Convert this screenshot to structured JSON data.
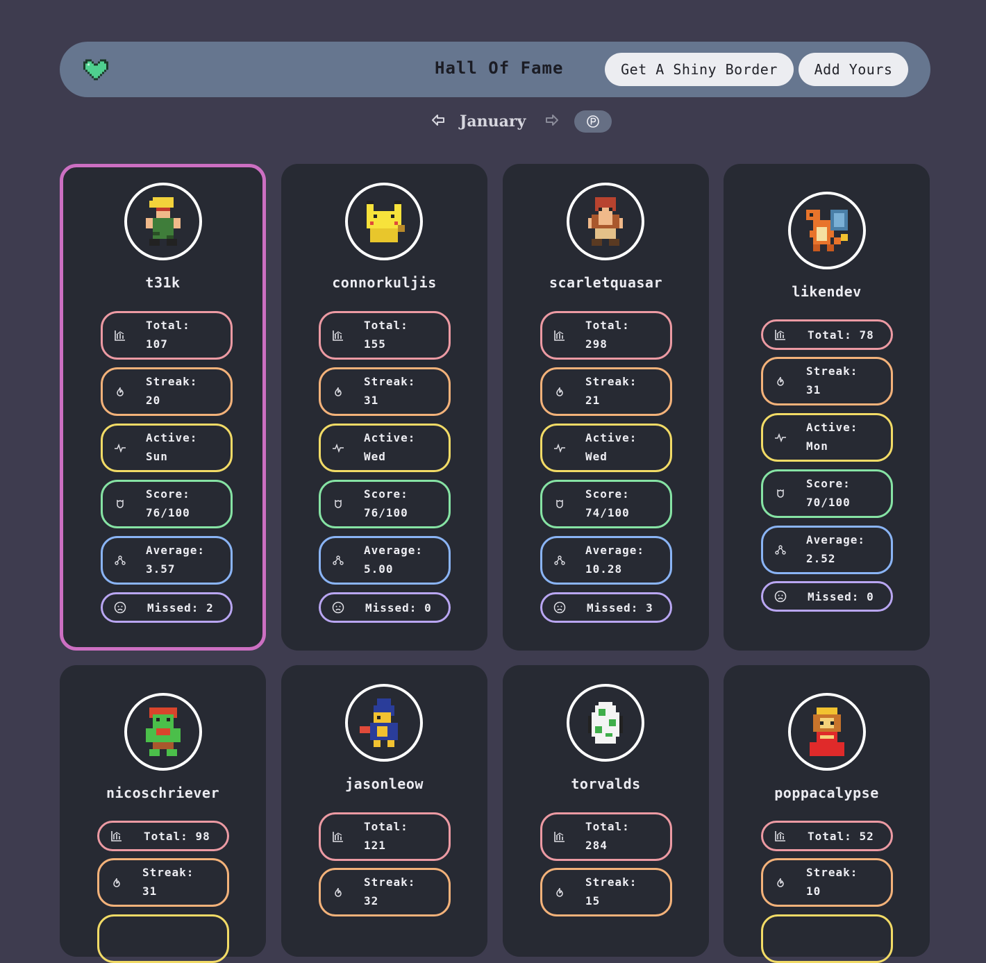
{
  "header": {
    "title": "Hall Of Fame",
    "shiny_button": "Get A Shiny Border",
    "add_button": "Add Yours",
    "logo_icon": "pixel-heart-icon",
    "accent": "#66768f"
  },
  "month_nav": {
    "month": "January",
    "prev_icon": "arrow-left-icon",
    "next_icon": "arrow-right-icon",
    "p_icon": "circle-p-icon"
  },
  "labels": {
    "total": "Total:",
    "streak": "Streak:",
    "active": "Active:",
    "score": "Score:",
    "average": "Average:",
    "missed": "Missed:"
  },
  "users": [
    {
      "name": "t31k",
      "total": "107",
      "streak": "20",
      "active": "Sun",
      "score": "76/100",
      "average": "3.57",
      "missed": "2",
      "shiny": true
    },
    {
      "name": "connorkuljis",
      "total": "155",
      "streak": "31",
      "active": "Wed",
      "score": "76/100",
      "average": "5.00",
      "missed": "0",
      "shiny": false
    },
    {
      "name": "scarletquasar",
      "total": "298",
      "streak": "21",
      "active": "Wed",
      "score": "74/100",
      "average": "10.28",
      "missed": "3",
      "shiny": false
    },
    {
      "name": "likendev",
      "total": "78",
      "streak": "31",
      "active": "Mon",
      "score": "70/100",
      "average": "2.52",
      "missed": "0",
      "shiny": false
    },
    {
      "name": "nicoschriever",
      "total": "98",
      "streak": "31",
      "shiny": false
    },
    {
      "name": "jasonleow",
      "total": "121",
      "streak": "32",
      "shiny": false
    },
    {
      "name": "torvalds",
      "total": "284",
      "streak": "15",
      "shiny": false
    },
    {
      "name": "poppacalypse",
      "total": "52",
      "streak": "10",
      "shiny": false
    }
  ],
  "colors": {
    "total": "#ec9aa3",
    "streak": "#f3b27a",
    "active": "#f2db66",
    "score": "#86e3a4",
    "average": "#8ab4f5",
    "missed": "#b9a6f2",
    "shiny_border": "#cc6fc2"
  }
}
